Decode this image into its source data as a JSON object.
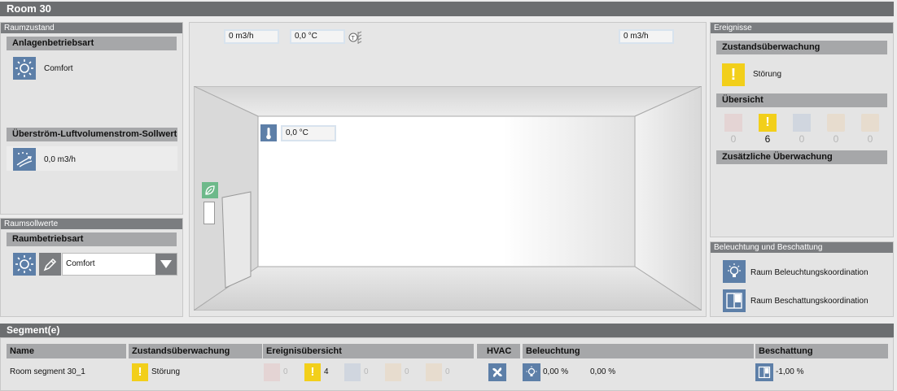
{
  "window": {
    "title": "Room 30"
  },
  "raumzustand": {
    "section_label": "Raumzustand",
    "anlagenbetriebsart": {
      "label": "Anlagenbetriebsart",
      "value": "Comfort",
      "icon": "sun-icon"
    },
    "ueberstroem": {
      "label": "Überström-Luftvolumenstrom-Sollwert",
      "value": "0,0 m3/h",
      "icon": "airflow-icon"
    }
  },
  "raumsollwerte": {
    "section_label": "Raumsollwerte",
    "raumbetriebsart": {
      "label": "Raumbetriebsart",
      "selected": "Comfort",
      "icon": "sun-icon"
    }
  },
  "room_view": {
    "supply_air": "0 m3/h",
    "supply_temp": "0,0 °C",
    "exhaust_air": "0 m3/h",
    "room_temp": "0,0 °C"
  },
  "ereignisse": {
    "section_label": "Ereignisse",
    "zustand": {
      "label": "Zustandsüberwachung",
      "status": "Störung"
    },
    "uebersicht": {
      "label": "Übersicht",
      "counts": [
        "0",
        "6",
        "0",
        "0",
        "0"
      ]
    },
    "zusaetzliche": {
      "label": "Zusätzliche Überwachung"
    }
  },
  "beleuchtung": {
    "section_label": "Beleuchtung und Beschattung",
    "items": [
      "Raum Beleuchtungskoordination",
      "Raum Beschattungskoordination"
    ]
  },
  "segments": {
    "title": "Segment(e)",
    "columns": [
      "Name",
      "Zustandsüberwachung",
      "Ereignisübersicht",
      "HVAC",
      "Beleuchtung",
      "Beschattung"
    ],
    "rows": [
      {
        "name": "Room segment 30_1",
        "status": "Störung",
        "event_counts": [
          "0",
          "4",
          "0",
          "0",
          "0"
        ],
        "light_1": "0,00 %",
        "light_2": "0,00 %",
        "shade": "-1,00 %"
      }
    ]
  },
  "colors": {
    "accent": "#5d7fa8",
    "warning": "#f2cf1a",
    "header": "#6c6e70",
    "subheader": "#a6a7a9"
  }
}
